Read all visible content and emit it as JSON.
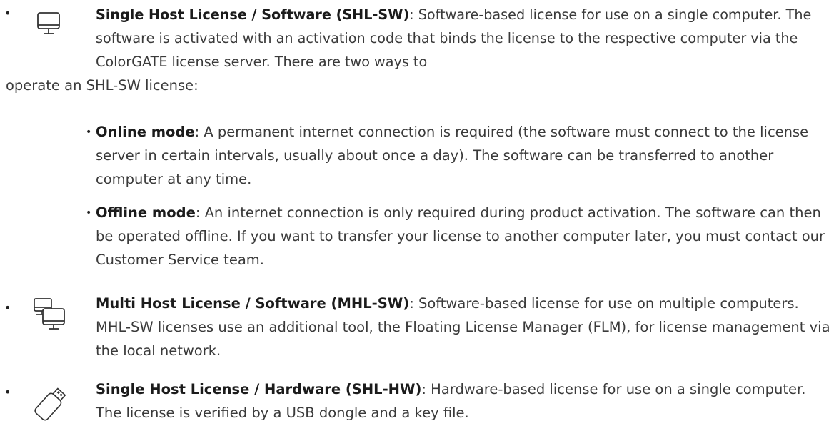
{
  "items": [
    {
      "icon": "monitor-icon",
      "title": "Single Host License / Software (SHL-SW)",
      "text": ": Software-based license for use on a single computer. The software is activated with an activation code that binds the license to the respective computer via the ColorGATE license server. There are two ways to",
      "tail": "operate an SHL-SW license:"
    },
    {
      "icon": "dual-monitor-icon",
      "title": "Multi Host License / Software (MHL-SW)",
      "text": ": Software-based license for use on multiple computers. MHL-SW licenses use an additional tool, the Floating License Manager (FLM), for license management via the local network."
    },
    {
      "icon": "usb-dongle-icon",
      "title": "Single Host License / Hardware (SHL-HW)",
      "text": ": Hardware-based license for use on a single computer. The license is verified by a USB dongle and a key file."
    }
  ],
  "modes": [
    {
      "title": "Online mode",
      "text": ": A permanent internet connection is required (the software must connect to the license server in certain intervals, usually about once a day). The software can be transferred to another computer at any time."
    },
    {
      "title": "Offline mode",
      "text": ": An internet connection is only required during product activation. The software can then be operated offline. If you want to transfer your license to another computer later, you must contact our Customer Service team."
    }
  ]
}
